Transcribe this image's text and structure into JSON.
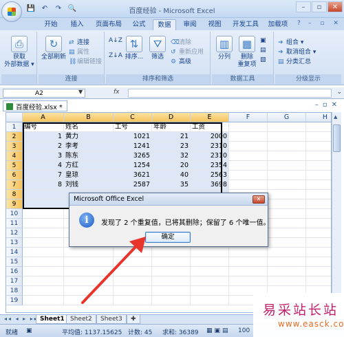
{
  "window": {
    "title": "百度经验 - Microsoft Excel"
  },
  "quick_access": {
    "save": "💾",
    "undo": "↶",
    "redo": "↷",
    "print_preview": "🔍"
  },
  "ribbon": {
    "tabs": [
      "开始",
      "插入",
      "页面布局",
      "公式",
      "数据",
      "审阅",
      "视图",
      "开发工具",
      "加载项"
    ],
    "active_tab": "数据",
    "help": "?",
    "groups": {
      "external": {
        "big": "获取\n外部数据",
        "big_l1": "获取",
        "big_l2": "外部数据 ▾",
        "label": ""
      },
      "connections": {
        "big_l1": "全部刷新",
        "connect": "连接",
        "props": "属性",
        "edit_links": "编辑链接",
        "label": "连接"
      },
      "sort": {
        "az": "A↓Z",
        "za": "Z↓A",
        "sort": "排序...",
        "filter": "筛选",
        "clear": "清除",
        "reapply": "重新应用",
        "advanced": "高级",
        "label": "排序和筛选"
      },
      "tools": {
        "split": "分列",
        "remove_l1": "删除",
        "remove_l2": "重复项",
        "label": "数据工具"
      },
      "outline": {
        "group": "组合 ▾",
        "ungroup": "取消组合 ▾",
        "subtotal": "分类汇总",
        "label": "分级显示"
      }
    }
  },
  "formula_bar": {
    "name_box": "A2",
    "fx": "fx",
    "value": ""
  },
  "workbook_tab": "百度经验.xlsx *",
  "sheet": {
    "columns": [
      "A",
      "B",
      "C",
      "D",
      "E",
      "F",
      "G",
      "H"
    ],
    "rows": [
      "1",
      "2",
      "3",
      "4",
      "5",
      "6",
      "7",
      "8",
      "9",
      "10",
      "11",
      "12",
      "13",
      "14",
      "15",
      "16",
      "17",
      "18",
      "19"
    ],
    "cells": {
      "A1": "编号",
      "B1": "姓名",
      "C1": "工号",
      "D1": "年龄",
      "E1": "工资",
      "A2": "1",
      "B2": "黄力",
      "C2": "1021",
      "D2": "21",
      "E2": "2000",
      "A3": "2",
      "B3": "李考",
      "C3": "1241",
      "D3": "23",
      "E3": "2310",
      "A4": "3",
      "B4": "陈东",
      "C4": "3265",
      "D4": "32",
      "E4": "2310",
      "A5": "4",
      "B5": "方红",
      "C5": "1254",
      "D5": "20",
      "E5": "2354",
      "A6": "7",
      "B6": "皇琼",
      "C6": "3621",
      "D6": "40",
      "E6": "2563",
      "A7": "8",
      "B7": "刘钱",
      "C7": "2587",
      "D7": "35",
      "E7": "3698"
    }
  },
  "sheet_tabs": [
    "Sheet1",
    "Sheet2",
    "Sheet3"
  ],
  "active_sheet": "Sheet1",
  "status": {
    "ready": "就绪",
    "average": "平均值: 1137.15625",
    "count": "计数: 45",
    "sum": "求和: 36389",
    "zoom": "100"
  },
  "dialog": {
    "title": "Microsoft Office Excel",
    "message": "发现了 2 个重复值，已将其删除；保留了 6 个唯一值。",
    "ok": "确定"
  },
  "watermark": {
    "cn": "易采站长站",
    "en": "www.easck.com"
  },
  "colors": {
    "arrow": "#e8342a",
    "selection_fill": "#dde7f5"
  }
}
